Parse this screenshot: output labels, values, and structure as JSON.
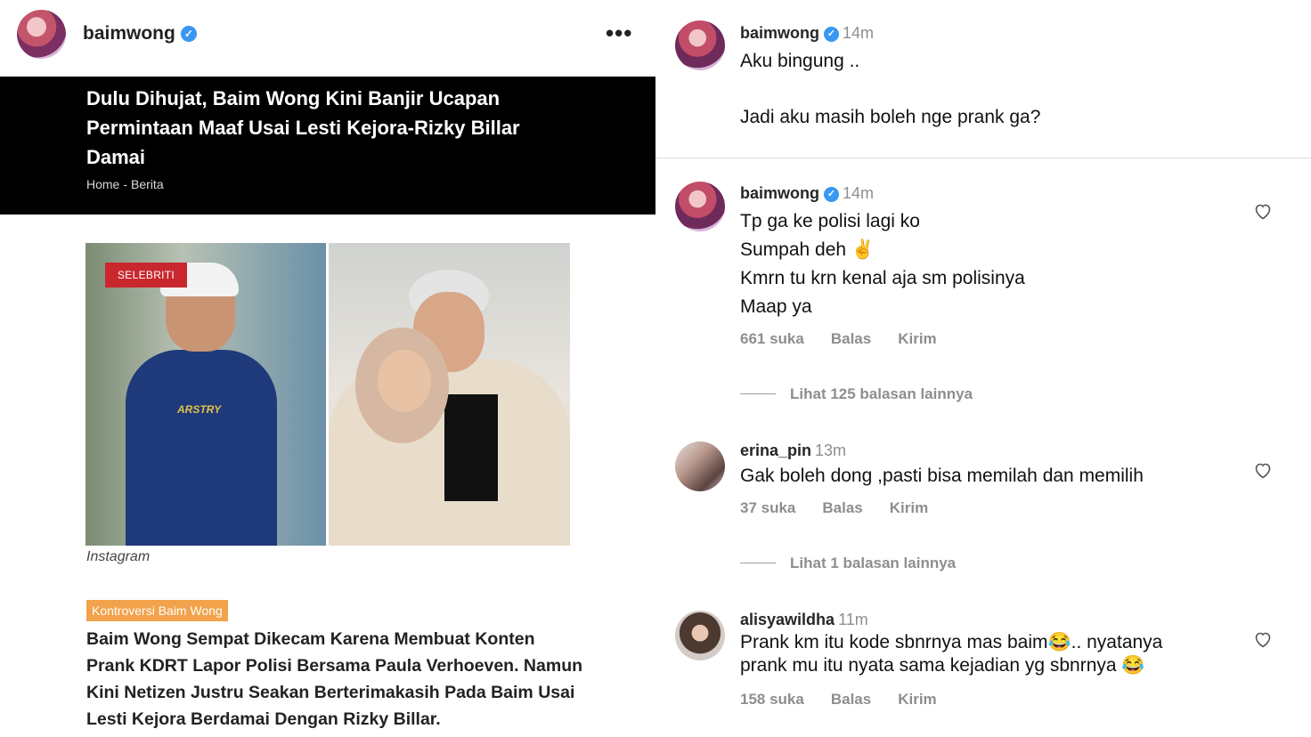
{
  "post": {
    "username": "baimwong",
    "verified_mark": "✓",
    "more_label": "•••"
  },
  "article": {
    "headline": "Dulu Dihujat, Baim Wong Kini Banjir Ucapan Permintaan Maaf Usai Lesti Kejora-Rizky Billar Damai",
    "breadcrumb": [
      "Home",
      "-",
      "Berita"
    ],
    "photo_badge": "SELEBRITI",
    "shirt_logo": "ARSTRY",
    "photo_caption": "Instagram",
    "tag": "Kontroversi Baim Wong",
    "lead": "Baim Wong Sempat Dikecam Karena Membuat Konten Prank KDRT Lapor Polisi Bersama Paula Verhoeven. Namun Kini Netizen Justru Seakan Berterimakasih Pada Baim Usai Lesti Kejora Berdamai Dengan Rizky Billar."
  },
  "caption": {
    "username": "baimwong",
    "time": "14m",
    "lines": [
      "Aku bingung ..",
      "Jadi aku masih boleh nge prank ga?"
    ]
  },
  "comments": [
    {
      "username": "baimwong",
      "verified": true,
      "time": "14m",
      "lines": [
        "Tp ga ke polisi lagi ko",
        "Sumpah deh ✌️",
        "Kmrn tu krn kenal aja sm polisinya",
        "Maap ya"
      ],
      "likes": "661 suka",
      "reply": "Balas",
      "send": "Kirim",
      "more_replies": "Lihat 125 balasan lainnya"
    },
    {
      "username": "erina_pin",
      "verified": false,
      "time": "13m",
      "lines": [
        "Gak boleh dong ,pasti bisa memilah dan memilih"
      ],
      "likes": "37 suka",
      "reply": "Balas",
      "send": "Kirim",
      "more_replies": "Lihat 1 balasan lainnya"
    },
    {
      "username": "alisyawildha",
      "verified": false,
      "time": "11m",
      "lines": [
        "Prank km itu kode sbnrnya mas baim😂.. nyatanya",
        "prank mu itu nyata sama kejadian yg sbnrnya 😂"
      ],
      "likes": "158 suka",
      "reply": "Balas",
      "send": "Kirim"
    }
  ],
  "icons": {
    "verified": "verified-badge-icon",
    "more": "more-horizontal-icon",
    "like": "heart-outline-icon"
  },
  "colors": {
    "verified": "#3897f0",
    "badge": "#c8272e",
    "tag": "#f2a24b",
    "muted": "#8e8e8e"
  }
}
